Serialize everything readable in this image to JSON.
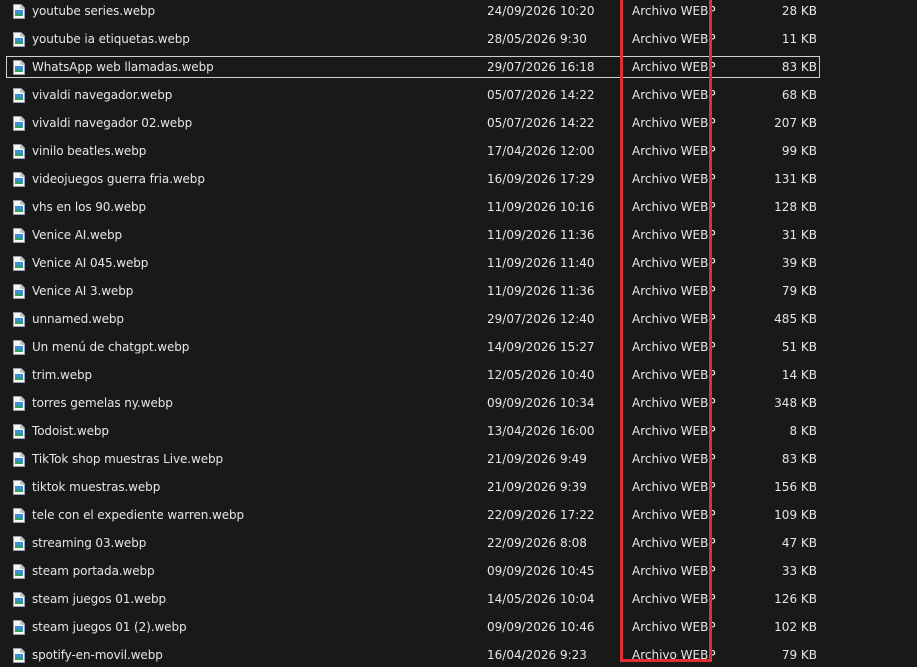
{
  "highlight_color": "#e02f33",
  "icon": "webp-file-icon",
  "files": [
    {
      "name": "youtube series.webp",
      "date": "24/09/2026 10:20",
      "type": "Archivo WEBP",
      "size": "28 KB",
      "selected": false
    },
    {
      "name": "youtube ia etiquetas.webp",
      "date": "28/05/2026 9:30",
      "type": "Archivo WEBP",
      "size": "11 KB",
      "selected": false
    },
    {
      "name": "WhatsApp web llamadas.webp",
      "date": "29/07/2026 16:18",
      "type": "Archivo WEBP",
      "size": "83 KB",
      "selected": true
    },
    {
      "name": "vivaldi navegador.webp",
      "date": "05/07/2026 14:22",
      "type": "Archivo WEBP",
      "size": "68 KB",
      "selected": false
    },
    {
      "name": "vivaldi navegador 02.webp",
      "date": "05/07/2026 14:22",
      "type": "Archivo WEBP",
      "size": "207 KB",
      "selected": false
    },
    {
      "name": "vinilo beatles.webp",
      "date": "17/04/2026 12:00",
      "type": "Archivo WEBP",
      "size": "99 KB",
      "selected": false
    },
    {
      "name": "videojuegos guerra fria.webp",
      "date": "16/09/2026 17:29",
      "type": "Archivo WEBP",
      "size": "131 KB",
      "selected": false
    },
    {
      "name": "vhs en los 90.webp",
      "date": "11/09/2026 10:16",
      "type": "Archivo WEBP",
      "size": "128 KB",
      "selected": false
    },
    {
      "name": "Venice AI.webp",
      "date": "11/09/2026 11:36",
      "type": "Archivo WEBP",
      "size": "31 KB",
      "selected": false
    },
    {
      "name": "Venice AI 045.webp",
      "date": "11/09/2026 11:40",
      "type": "Archivo WEBP",
      "size": "39 KB",
      "selected": false
    },
    {
      "name": "Venice AI 3.webp",
      "date": "11/09/2026 11:36",
      "type": "Archivo WEBP",
      "size": "79 KB",
      "selected": false
    },
    {
      "name": "unnamed.webp",
      "date": "29/07/2026 12:40",
      "type": "Archivo WEBP",
      "size": "485 KB",
      "selected": false
    },
    {
      "name": "Un menú de chatgpt.webp",
      "date": "14/09/2026 15:27",
      "type": "Archivo WEBP",
      "size": "51 KB",
      "selected": false
    },
    {
      "name": "trim.webp",
      "date": "12/05/2026 10:40",
      "type": "Archivo WEBP",
      "size": "14 KB",
      "selected": false
    },
    {
      "name": "torres gemelas ny.webp",
      "date": "09/09/2026 10:34",
      "type": "Archivo WEBP",
      "size": "348 KB",
      "selected": false
    },
    {
      "name": "Todoist.webp",
      "date": "13/04/2026 16:00",
      "type": "Archivo WEBP",
      "size": "8 KB",
      "selected": false
    },
    {
      "name": "TikTok shop muestras Live.webp",
      "date": "21/09/2026 9:49",
      "type": "Archivo WEBP",
      "size": "83 KB",
      "selected": false
    },
    {
      "name": "tiktok muestras.webp",
      "date": "21/09/2026 9:39",
      "type": "Archivo WEBP",
      "size": "156 KB",
      "selected": false
    },
    {
      "name": "tele con el expediente warren.webp",
      "date": "22/09/2026 17:22",
      "type": "Archivo WEBP",
      "size": "109 KB",
      "selected": false
    },
    {
      "name": "streaming 03.webp",
      "date": "22/09/2026 8:08",
      "type": "Archivo WEBP",
      "size": "47 KB",
      "selected": false
    },
    {
      "name": "steam portada.webp",
      "date": "09/09/2026 10:45",
      "type": "Archivo WEBP",
      "size": "33 KB",
      "selected": false
    },
    {
      "name": "steam juegos 01.webp",
      "date": "14/05/2026 10:04",
      "type": "Archivo WEBP",
      "size": "126 KB",
      "selected": false
    },
    {
      "name": "steam juegos 01 (2).webp",
      "date": "09/09/2026 10:46",
      "type": "Archivo WEBP",
      "size": "102 KB",
      "selected": false
    },
    {
      "name": "spotify-en-movil.webp",
      "date": "16/04/2026 9:23",
      "type": "Archivo WEBP",
      "size": "79 KB",
      "selected": false
    }
  ]
}
